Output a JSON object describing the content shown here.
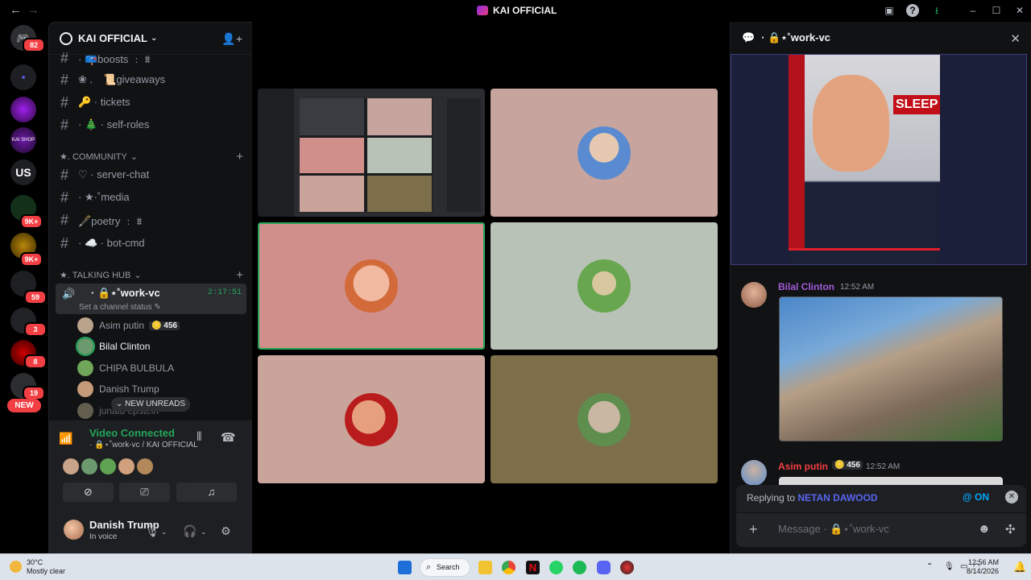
{
  "titlebar": {
    "title": "KAI OFFICIAL",
    "back": "←",
    "forward": "→"
  },
  "rail": {
    "home_badge": "82",
    "badges": [
      "9K+",
      "9K+",
      "59",
      "3",
      "8",
      "19"
    ],
    "new_label": "NEW"
  },
  "guild": {
    "name": "KAI OFFICIAL"
  },
  "channels": {
    "top": [
      {
        "label": "· 📪boosts ﹕ ⩩"
      },
      {
        "label": "❀ . ⠀📜giveaways"
      },
      {
        "label": "🔑 · tickets"
      },
      {
        "label": "· 🎄 · self-roles"
      }
    ],
    "community_label": "★. COMMUNITY",
    "community": [
      {
        "label": "♡ · server-chat"
      },
      {
        "label": "· ★·˚media"
      },
      {
        "label": "🖋️poetry ﹕ ⩩"
      },
      {
        "label": "· ☁️ · bot-cmd"
      }
    ],
    "talking_hub_label": "★. TALKING HUB"
  },
  "voice_channel": {
    "name": "· 🔒⋆˚work-vc",
    "timer": "2:17:51",
    "status": "Set a channel status",
    "users": [
      {
        "name": "Asim putin",
        "pill": "🪙 456",
        "color": "#b9a38b"
      },
      {
        "name": "Bilal Clinton",
        "pill": "",
        "color": "#6a9a6e"
      },
      {
        "name": "CHIPA BULBULA",
        "pill": "",
        "color": "#6fa65a"
      },
      {
        "name": "Danish Trump",
        "pill": "",
        "color": "#c59b7a"
      },
      {
        "name": "junaid epstein",
        "pill": "",
        "color": "#9a8f75"
      }
    ],
    "new_unreads": "⌄ NEW UNREADS"
  },
  "connection": {
    "title": "Video Connected",
    "subtitle": "· 🔒⋆˚work-vc / KAI OFFICIAL",
    "avatar_colors": [
      "#c9a489",
      "#6a9a6e",
      "#5fa352",
      "#d1a07c",
      "#b2875a"
    ]
  },
  "user": {
    "name": "Danish Trump",
    "status": "In voice"
  },
  "tiles": [
    {
      "name": "screen-share",
      "bg": "#2a2c30"
    },
    {
      "name": "putin",
      "bg": "#c7a59e",
      "avatar": "#5a8bd0"
    },
    {
      "name": "baby-face",
      "bg": "#d08f8a",
      "avatar": "#d79b7e"
    },
    {
      "name": "green-man",
      "bg": "#b9c2b6",
      "avatar": "#68a64f"
    },
    {
      "name": "trump",
      "bg": "#c9a49b",
      "avatar": "#d0896b"
    },
    {
      "name": "epstein",
      "bg": "#7c6f49",
      "avatar": "#8e8f86"
    }
  ],
  "chat": {
    "channel": "· 🔒⋆˚work-vc",
    "image_caption": "SLEEP",
    "messages": [
      {
        "author": "Bilal Clinton",
        "time": "12:52 AM",
        "color": "#a35bd8"
      },
      {
        "author": "Asim putin",
        "pill": "🪙 456",
        "time": "12:52 AM",
        "color": "#f23f43"
      }
    ],
    "replying_to_label": "Replying to",
    "replying_to_user": "NETAN DAWOOD",
    "mention_toggle": "@ ON",
    "composer_placeholder": "Message · 🔒⋆˚work-vc"
  },
  "taskbar": {
    "weather_temp": "30°C",
    "weather_desc": "Mostly clear",
    "search_label": "Search",
    "time": "12:56 AM",
    "date": "8/14/2026"
  }
}
